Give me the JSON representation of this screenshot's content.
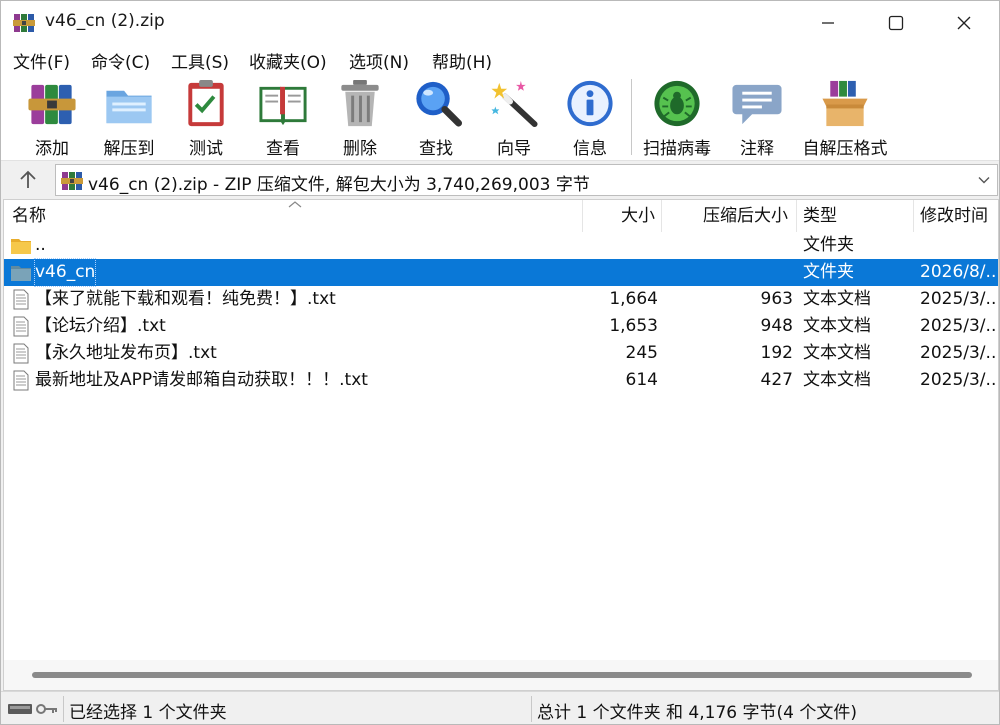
{
  "window": {
    "title": "v46_cn (2).zip"
  },
  "menu": [
    {
      "label": "文件(F)"
    },
    {
      "label": "命令(C)"
    },
    {
      "label": "工具(S)"
    },
    {
      "label": "收藏夹(O)"
    },
    {
      "label": "选项(N)"
    },
    {
      "label": "帮助(H)"
    }
  ],
  "toolbar": [
    {
      "label": "添加",
      "icon": "add-icon"
    },
    {
      "label": "解压到",
      "icon": "extract-to-icon"
    },
    {
      "label": "测试",
      "icon": "test-icon"
    },
    {
      "label": "查看",
      "icon": "view-icon"
    },
    {
      "label": "删除",
      "icon": "delete-icon"
    },
    {
      "label": "查找",
      "icon": "find-icon"
    },
    {
      "label": "向导",
      "icon": "wizard-icon"
    },
    {
      "label": "信息",
      "icon": "info-icon"
    },
    {
      "label": "扫描病毒",
      "icon": "virus-scan-icon"
    },
    {
      "label": "注释",
      "icon": "comment-icon"
    },
    {
      "label": "自解压格式",
      "icon": "sfx-icon"
    }
  ],
  "address": {
    "text": "v46_cn (2).zip - ZIP 压缩文件, 解包大小为 3,740,269,003 字节"
  },
  "columns": {
    "name": "名称",
    "size": "大小",
    "packed": "压缩后大小",
    "type": "类型",
    "modified": "修改时间"
  },
  "files": [
    {
      "name": "..",
      "size": "",
      "packed": "",
      "type": "文件夹",
      "modified": "",
      "kind": "folder-up",
      "selected": false
    },
    {
      "name": "v46_cn",
      "size": "",
      "packed": "",
      "type": "文件夹",
      "modified": "2026/8/...",
      "kind": "folder",
      "selected": true
    },
    {
      "name": "【来了就能下载和观看！纯免费！】.txt",
      "size": "1,664",
      "packed": "963",
      "type": "文本文档",
      "modified": "2025/3/...",
      "kind": "text",
      "selected": false
    },
    {
      "name": "【论坛介绍】.txt",
      "size": "1,653",
      "packed": "948",
      "type": "文本文档",
      "modified": "2025/3/...",
      "kind": "text",
      "selected": false
    },
    {
      "name": "【永久地址发布页】.txt",
      "size": "245",
      "packed": "192",
      "type": "文本文档",
      "modified": "2025/3/...",
      "kind": "text",
      "selected": false
    },
    {
      "name": "最新地址及APP请发邮箱自动获取！！！.txt",
      "size": "614",
      "packed": "427",
      "type": "文本文档",
      "modified": "2025/3/...",
      "kind": "text",
      "selected": false
    }
  ],
  "status": {
    "left": "已经选择 1 个文件夹",
    "right": "总计 1 个文件夹 和 4,176 字节(4 个文件)"
  },
  "colors": {
    "selection": "#0a78d7",
    "folder": "#f3c245",
    "folder_selected": "#7aa3b8"
  }
}
